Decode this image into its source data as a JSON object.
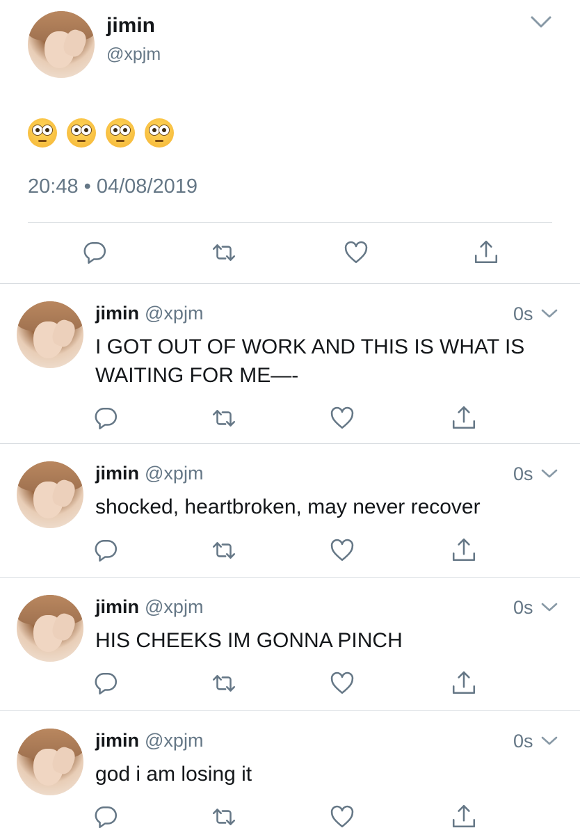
{
  "main_tweet": {
    "name": "jimin",
    "handle": "@xpjm",
    "emoji_text": "😳😳😳😳",
    "timestamp": "20:48 • 04/08/2019",
    "actions": [
      "reply-icon",
      "retweet-icon",
      "like-icon",
      "share-icon"
    ]
  },
  "replies": [
    {
      "name": "jimin",
      "handle": "@xpjm",
      "time": "0s",
      "text": "I GOT OUT OF WORK AND THIS IS WHAT IS WAITING FOR ME—-"
    },
    {
      "name": "jimin",
      "handle": "@xpjm",
      "time": "0s",
      "text": "shocked, heartbroken, may never recover"
    },
    {
      "name": "jimin",
      "handle": "@xpjm",
      "time": "0s",
      "text": "HIS CHEEKS IM GONNA PINCH"
    },
    {
      "name": "jimin",
      "handle": "@xpjm",
      "time": "0s",
      "text": "god i am losing it"
    }
  ],
  "colors": {
    "text": "#14171a",
    "secondary": "#657786",
    "divider": "#d8dde1",
    "icon": "#657786"
  }
}
